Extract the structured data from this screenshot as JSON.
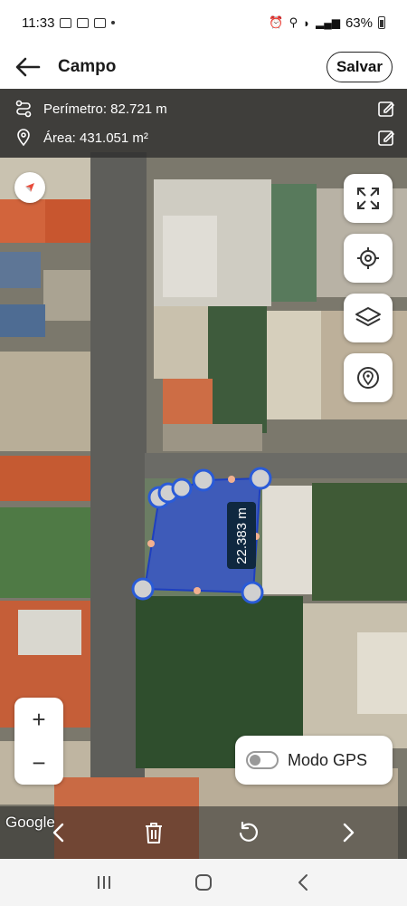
{
  "status": {
    "time": "11:33",
    "battery": "63%"
  },
  "header": {
    "title": "Campo",
    "save_label": "Salvar"
  },
  "info": {
    "perimeter": "Perímetro: 82.721 m",
    "area": "Área: 431.051 m²"
  },
  "map": {
    "measurement": "22.383 m",
    "google_label": "Google",
    "gps_label": "Modo GPS",
    "gps_enabled": false,
    "zoom_in": "+",
    "zoom_out": "−"
  },
  "icons": {
    "back": "arrow-left-icon",
    "perimeter": "route-icon",
    "area": "location-pin-icon",
    "edit": "edit-icon",
    "compass": "compass-icon",
    "fullscreen": "expand-icon",
    "locate": "crosshair-icon",
    "layers": "layers-icon",
    "gps_point": "target-pin-icon",
    "delete": "trash-icon",
    "undo": "undo-icon"
  },
  "colors": {
    "polygon_fill": "#2f50d6",
    "vertex": "#2a5bd7",
    "accent": "#0f2840"
  }
}
